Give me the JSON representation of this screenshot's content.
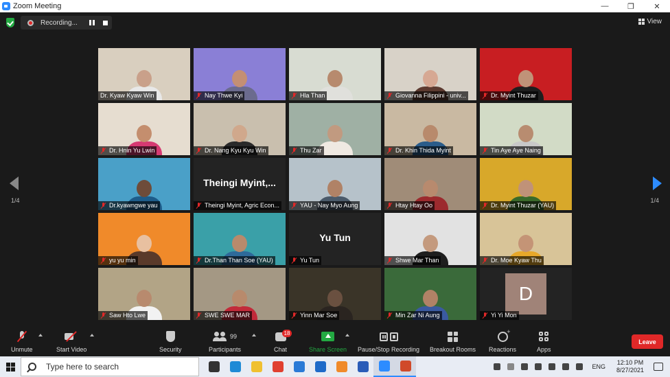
{
  "window": {
    "title": "Zoom Meeting",
    "minimize": "—",
    "restore": "❐",
    "close": "✕"
  },
  "topbar": {
    "recording_label": "Recording...",
    "view_label": "View"
  },
  "pager": {
    "left": "1/4",
    "right": "1/4"
  },
  "participants": [
    {
      "name": "Dr. Kyaw Kyaw Win",
      "muted": false,
      "bg": "#d9cfbf",
      "skin": "#c9a08a",
      "shirt": "#e8e8e8"
    },
    {
      "name": "Nay Thwe Kyi",
      "muted": true,
      "bg": "#8a7fd6",
      "skin": "#c48f74",
      "shirt": "#6b6b8e"
    },
    {
      "name": "Hla Than",
      "muted": true,
      "bg": "#d8dcd2",
      "skin": "#b78a6e",
      "shirt": "#e0e0dc"
    },
    {
      "name": "Giovanna Filippini - univ...",
      "muted": true,
      "bg": "#d8d2c8",
      "skin": "#d6a893",
      "shirt": "#5c3a30"
    },
    {
      "name": "Dr. Myint Thuzar",
      "muted": true,
      "bg": "#c81e22",
      "skin": "#c09278",
      "shirt": "#1e1e1e"
    },
    {
      "name": "Dr. Hnin Yu Lwin",
      "muted": true,
      "bg": "#e6ddd0",
      "skin": "#c48e6e",
      "shirt": "#d63a72"
    },
    {
      "name": "Dr. Nang Kyu Kyu Win",
      "muted": true,
      "bg": "#c9bfae",
      "skin": "#d0a88c",
      "shirt": "#2a2a2a"
    },
    {
      "name": "Thu Zar",
      "muted": true,
      "bg": "#9fb0a4",
      "skin": "#c19a80",
      "shirt": "#efe9e2"
    },
    {
      "name": "Dr. Khin Thida Myint",
      "muted": true,
      "bg": "#c9b9a2",
      "skin": "#b88a6c",
      "shirt": "#2a5c8a"
    },
    {
      "name": "Tin Aye Aye Naing",
      "muted": true,
      "bg": "#d2dbc6",
      "skin": "#b88c70",
      "shirt": "#c8c8c8"
    },
    {
      "name": "Dr.kyawngwe yau",
      "muted": true,
      "bg": "#4aa0c8",
      "skin": "#6e4c3a",
      "shirt": "#1d5c8a"
    },
    {
      "name": "Theingi Myint, Agric Econ...",
      "muted": true,
      "bg": "",
      "big": "Theingi  Myint,..."
    },
    {
      "name": "YAU - Nay Myo Aung",
      "muted": true,
      "bg": "#b6c2ca",
      "skin": "#b08266",
      "shirt": "#4a5a6a"
    },
    {
      "name": "Htay Htay Oo",
      "muted": true,
      "bg": "#a08c78",
      "skin": "#b88a6e",
      "shirt": "#9c2a2e"
    },
    {
      "name": "Dr. Myint Thuzar (YAU)",
      "muted": true,
      "bg": "#d8a82a",
      "skin": "#c09278",
      "shirt": "#3a6a2a"
    },
    {
      "name": "yu yu min",
      "muted": true,
      "bg": "#f08a2a",
      "skin": "#e8c0a0",
      "shirt": "#5a3a2a"
    },
    {
      "name": "Dr.Than Than Soe (YAU)",
      "muted": true,
      "bg": "#3aa0a8",
      "skin": "#b88a6c",
      "shirt": "#2e6a9a"
    },
    {
      "name": "Yu Tun",
      "muted": true,
      "bg": "",
      "big": "Yu Tun"
    },
    {
      "name": "Shwe Mar Than",
      "muted": true,
      "bg": "#e2e2e2",
      "skin": "#c49a7e",
      "shirt": "#1e1e1e"
    },
    {
      "name": "Dr. Moe Kyaw Thu",
      "muted": true,
      "bg": "#d8c498",
      "skin": "#c49476",
      "shirt": "#e8a82a"
    },
    {
      "name": "Saw Hto Lwe",
      "muted": true,
      "bg": "#b2a486",
      "skin": "#b88a6e",
      "shirt": "#f2f2f2"
    },
    {
      "name": "SWE SWE MAR",
      "muted": true,
      "bg": "#a49884",
      "skin": "#b88a6c",
      "shirt": "#c22a3a"
    },
    {
      "name": "Yinn Mar Soe",
      "muted": true,
      "bg": "#3a3428",
      "skin": "#6a5040",
      "shirt": "#2a2420"
    },
    {
      "name": "Min Zar Ni Aung",
      "muted": true,
      "bg": "#3a6a3a",
      "skin": "#b08266",
      "shirt": "#3a5aa0"
    },
    {
      "name": "Yi Yi Mon",
      "muted": true,
      "bg": "",
      "letter": "D"
    }
  ],
  "toolbar": {
    "unmute": "Unmute",
    "start_video": "Start Video",
    "security": "Security",
    "participants": "Participants",
    "participants_count": "99",
    "chat": "Chat",
    "chat_badge": "18",
    "share_screen": "Share Screen",
    "pause_stop": "Pause/Stop Recording",
    "breakout": "Breakout Rooms",
    "reactions": "Reactions",
    "apps": "Apps",
    "leave": "Leave"
  },
  "taskbar": {
    "search_placeholder": "Type here to search",
    "lang": "ENG",
    "time": "12:10 PM",
    "date": "8/27/2021",
    "apps": [
      {
        "name": "task-view",
        "color": "#333333"
      },
      {
        "name": "edge",
        "color": "#1e8ad6"
      },
      {
        "name": "file-explorer",
        "color": "#f0c030"
      },
      {
        "name": "chrome",
        "color": "#e04030"
      },
      {
        "name": "store",
        "color": "#2a7ad6"
      },
      {
        "name": "mail",
        "color": "#1e6ac8"
      },
      {
        "name": "firefox",
        "color": "#f08a2a"
      },
      {
        "name": "word",
        "color": "#2a5cb8"
      },
      {
        "name": "zoom",
        "color": "#2d8cff"
      },
      {
        "name": "powerpoint",
        "color": "#d04a2a"
      }
    ]
  }
}
